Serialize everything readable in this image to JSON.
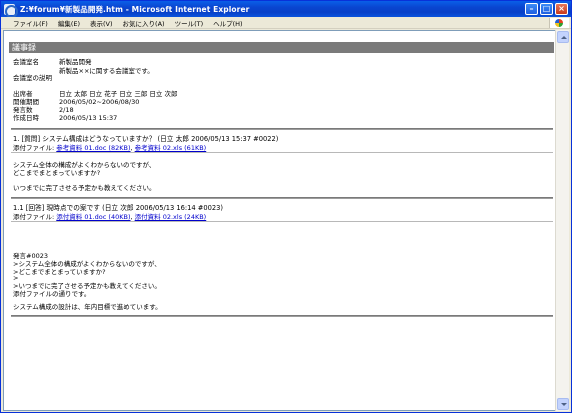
{
  "window": {
    "title": "Z:¥forum¥新製品開発.htm - Microsoft Internet Explorer"
  },
  "menu": [
    "ファイル(F)",
    "編集(E)",
    "表示(V)",
    "お気に入り(A)",
    "ツール(T)",
    "ヘルプ(H)"
  ],
  "page": {
    "section_title": "議事録",
    "info": {
      "room_name_label": "会議室名",
      "room_name": "新製品開発",
      "description_label": "会議室の説明",
      "description": "新製品××に関する会議室です。",
      "attendees_label": "出席者",
      "attendees": "日立 太郎 日立 花子 日立 三郎 日立 次郎",
      "period_label": "開催期間",
      "period": "2006/05/02~2006/08/30",
      "count_label": "発言数",
      "count": "2/18",
      "created_label": "作成日時",
      "created": "2006/05/13 15:37"
    },
    "posts": [
      {
        "header": "1. [質問] システム構成はどうなっていますか？ (日立 太郎 2006/05/13 15:37 #0022)",
        "attach_label": "添付ファイル:",
        "attachments": [
          "参考資料 01.doc (82KB)",
          "参考資料 02.xls (61KB)"
        ],
        "body": [
          "システム全体の構成がよくわからないのですが、",
          "どこまでまとまっていますか?",
          "",
          "いつまでに完了させる予定かも教えてください。"
        ]
      },
      {
        "header": "1.1 [回答] 現時点での案です (日立 次郎 2006/05/13 16:14 #0023)",
        "attach_label": "添付ファイル:",
        "attachments": [
          "添付資料 01.doc (40KB)",
          "添付資料 02.xls (24KB)"
        ],
        "body": [
          "発言#0023",
          ">システム全体の構成がよくわからないのですが、",
          ">どこまでまとまっていますか?",
          ">",
          ">いつまでに完了させる予定かも教えてください。",
          "添付ファイルの通りです。",
          "",
          "システム構成の設計は、年内目標で進めています。"
        ]
      }
    ]
  }
}
